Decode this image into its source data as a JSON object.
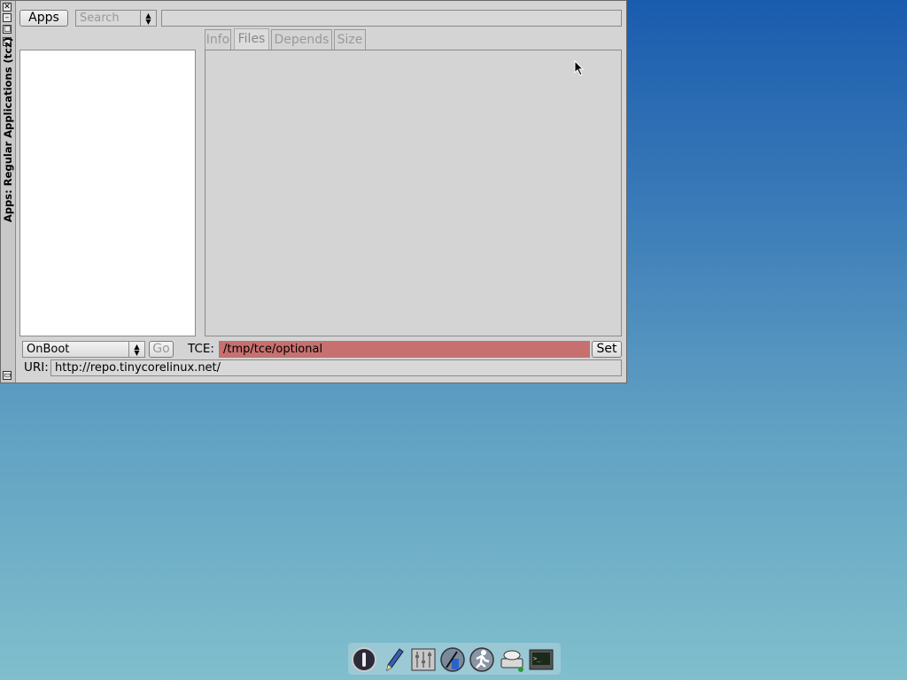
{
  "window": {
    "title": "Apps: Regular Applications (tcz)",
    "buttons": [
      "close-icon",
      "minimize-icon",
      "maximize-icon",
      "shade-icon"
    ]
  },
  "toolbar": {
    "apps_label": "Apps",
    "search_placeholder": "Search",
    "search_field_value": ""
  },
  "tabs": [
    {
      "label": "Info",
      "active": false
    },
    {
      "label": "Files",
      "active": true
    },
    {
      "label": "Depends",
      "active": false
    },
    {
      "label": "Size",
      "active": false
    }
  ],
  "bottom": {
    "mode_selected": "OnBoot",
    "go_label": "Go",
    "tce_label": "TCE:",
    "tce_value": "/tmp/tce/optional",
    "set_label": "Set",
    "uri_label": "URI:",
    "uri_value": "http://repo.tinycorelinux.net/"
  },
  "colors": {
    "tce_field_bg": "#c87070",
    "window_bg": "#d4d4d4"
  },
  "dock": {
    "icons": [
      "exit-icon",
      "editor-icon",
      "control-panel-icon",
      "mount-tool-icon",
      "apps-icon",
      "mount-drive-icon",
      "terminal-icon"
    ]
  }
}
